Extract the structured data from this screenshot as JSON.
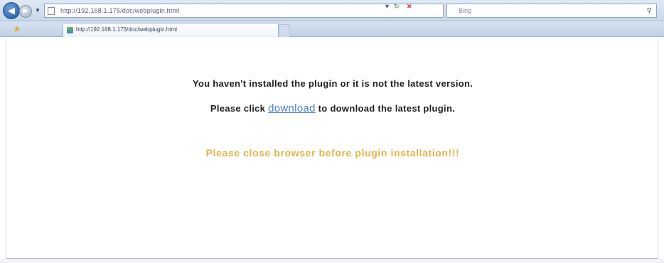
{
  "browser": {
    "address_url": "http://192.168.1.175/doc/webplugin.html",
    "search_placeholder": "Bing",
    "tab_title": "http://192.168.1.175/doc/webplugin.html",
    "icons": {
      "back": "back-arrow-icon",
      "forward": "forward-arrow-icon",
      "refresh": "refresh-icon",
      "stop": "stop-icon",
      "search": "search-icon",
      "favorites": "favorites-star-icon"
    }
  },
  "page": {
    "line1": "You haven't installed the plugin or it is not the latest version.",
    "line2_before": "Please click ",
    "download_link": "download",
    "line2_after": " to download the latest plugin.",
    "warning": "Please close browser before plugin installation!!!"
  },
  "colors": {
    "link": "#4d7fd0",
    "warning": "#e0b44a",
    "text": "#1f1f1f"
  }
}
